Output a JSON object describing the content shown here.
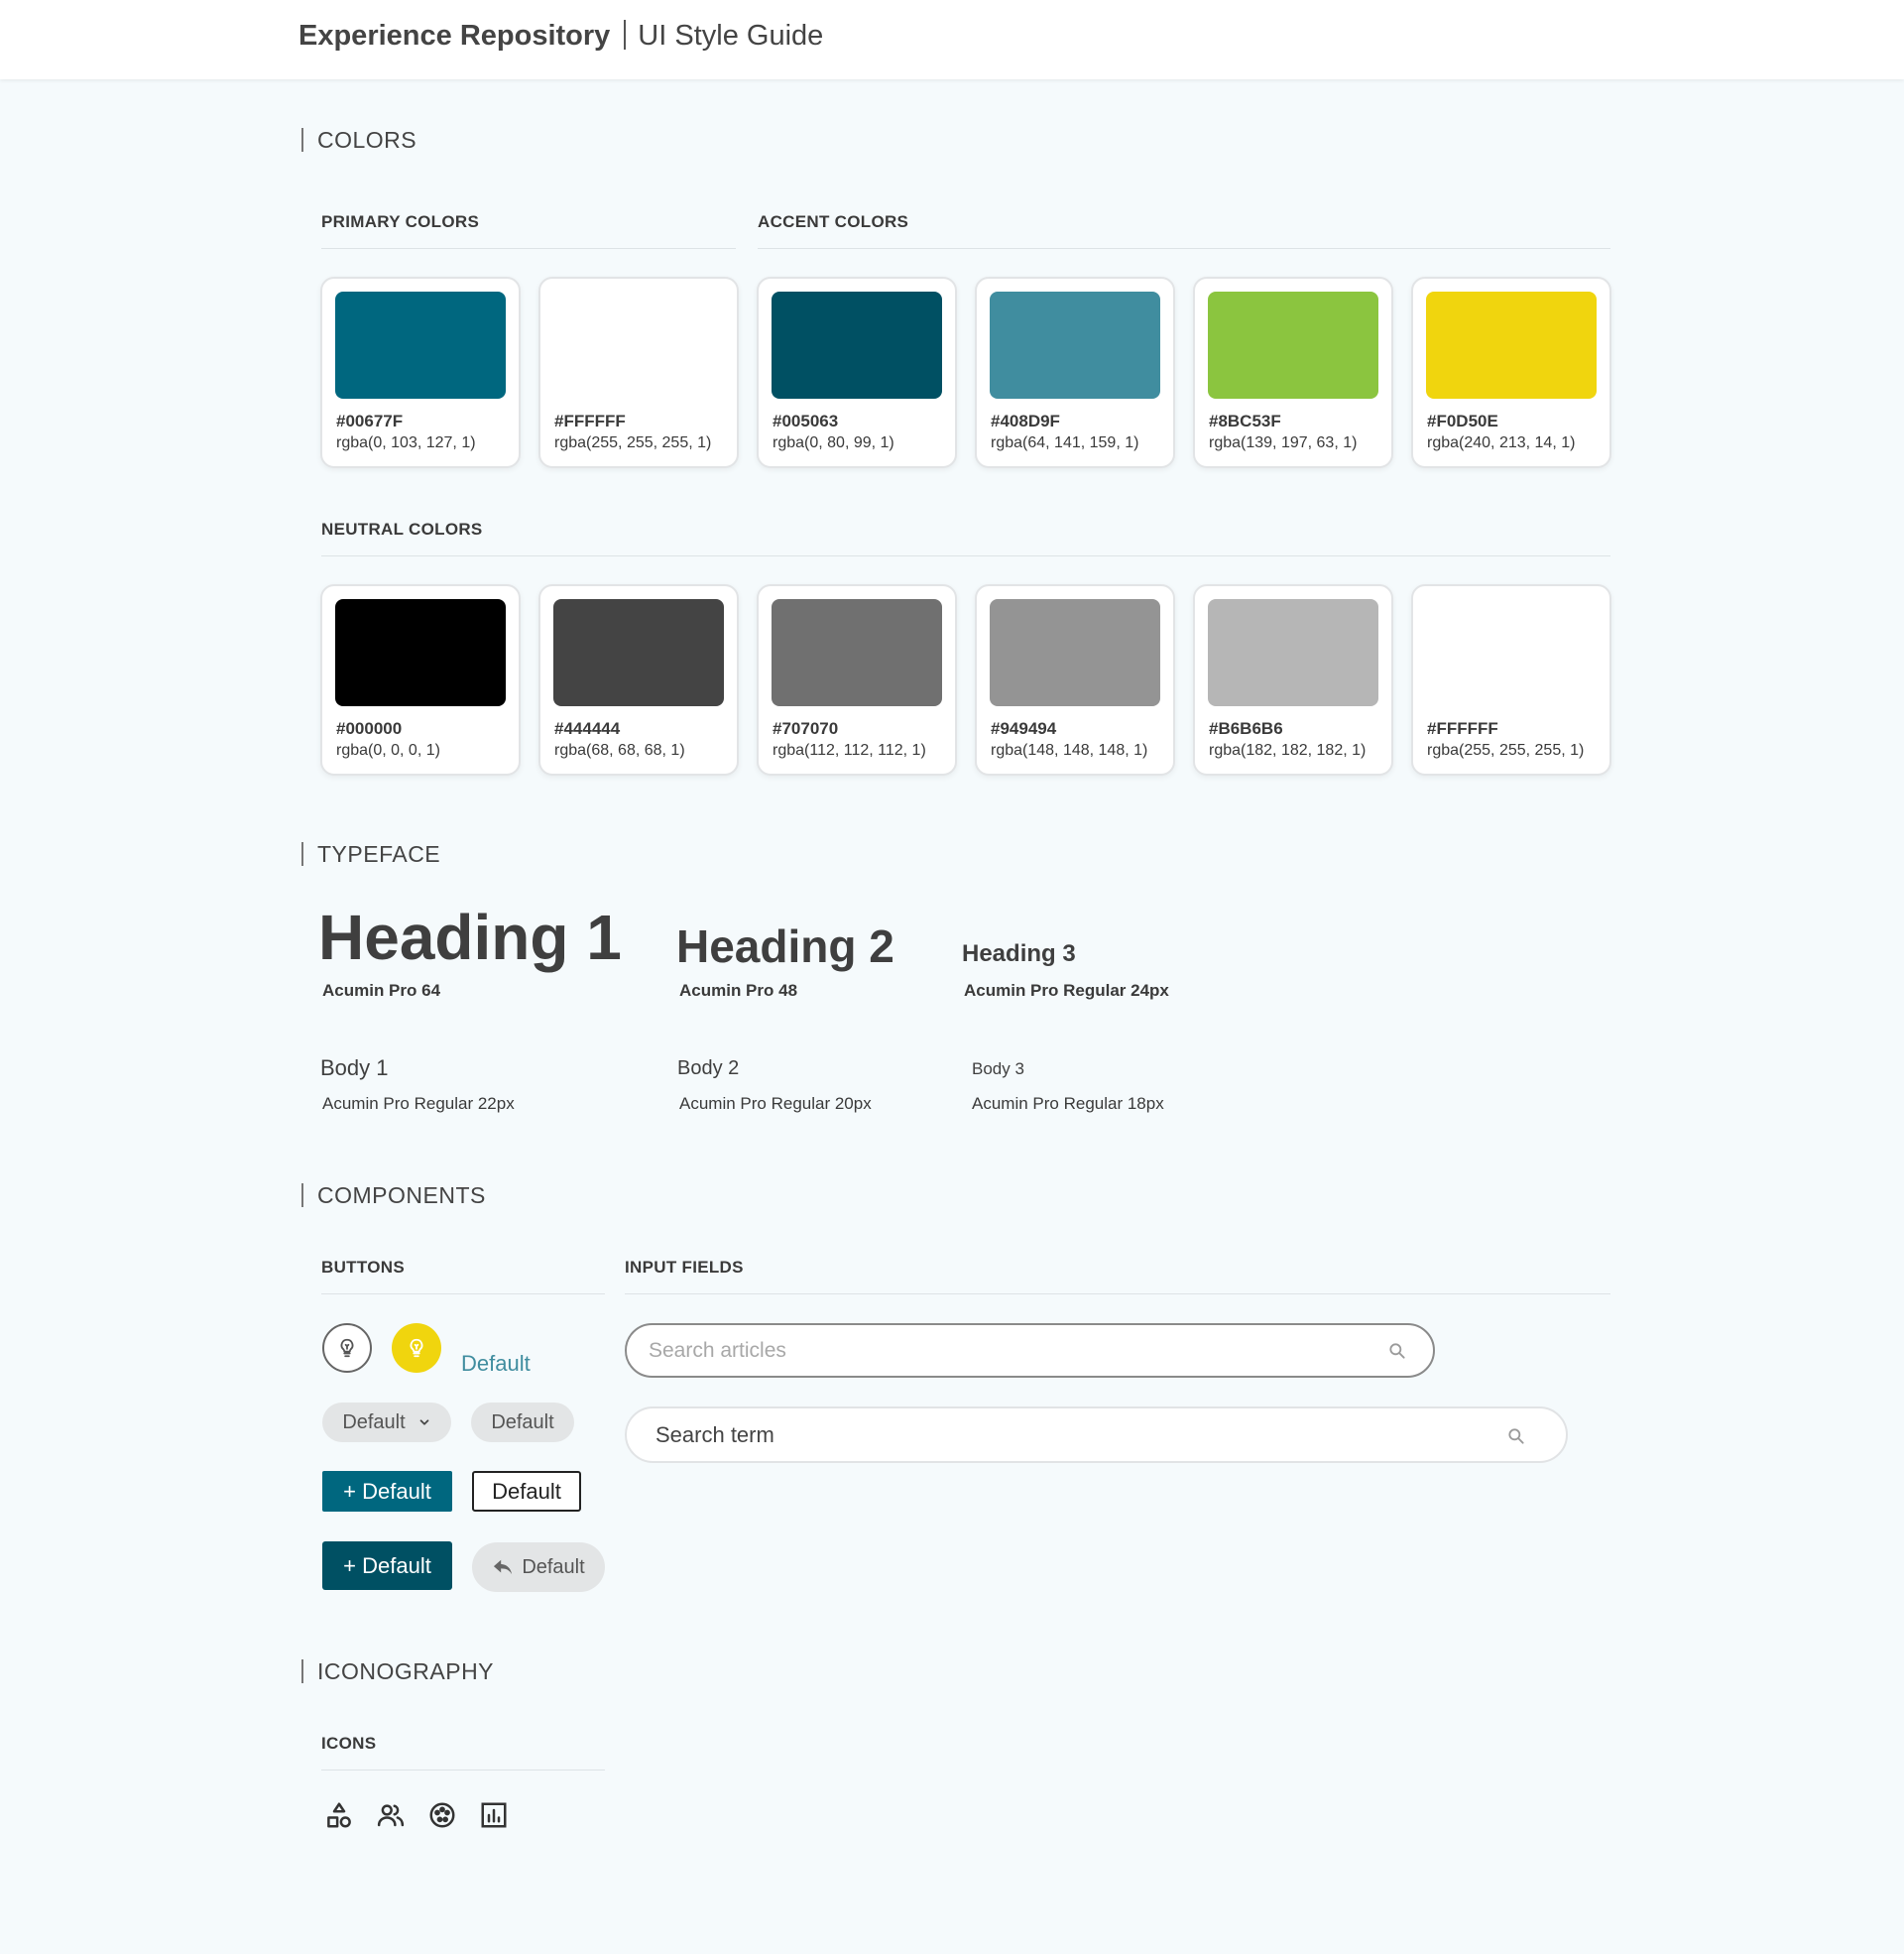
{
  "header": {
    "brand": "Experience Repository",
    "subtitle": "UI Style Guide"
  },
  "sections": {
    "colors": "COLORS",
    "typeface": "TYPEFACE",
    "components": "COMPONENTS",
    "iconography": "ICONOGRAPHY"
  },
  "colors": {
    "primary_title": "PRIMARY COLORS",
    "accent_title": "ACCENT COLORS",
    "neutral_title": "NEUTRAL COLORS",
    "primary": [
      {
        "hex": "#00677F",
        "rgba": "rgba(0, 103, 127, 1)",
        "color": "#00677F"
      },
      {
        "hex": "#FFFFFF",
        "rgba": "rgba(255, 255, 255, 1)",
        "color": "#FFFFFF"
      }
    ],
    "accent": [
      {
        "hex": "#005063",
        "rgba": "rgba(0, 80, 99, 1)",
        "color": "#005063"
      },
      {
        "hex": "#408D9F",
        "rgba": "rgba(64, 141, 159, 1)",
        "color": "#408D9F"
      },
      {
        "hex": "#8BC53F",
        "rgba": "rgba(139, 197, 63, 1)",
        "color": "#8BC53F"
      },
      {
        "hex": "#F0D50E",
        "rgba": "rgba(240, 213, 14, 1)",
        "color": "#F0D50E"
      }
    ],
    "neutral": [
      {
        "hex": "#000000",
        "rgba": "rgba(0, 0, 0, 1)",
        "color": "#000000"
      },
      {
        "hex": "#444444",
        "rgba": "rgba(68, 68, 68, 1)",
        "color": "#444444"
      },
      {
        "hex": "#707070",
        "rgba": "rgba(112, 112, 112, 1)",
        "color": "#707070"
      },
      {
        "hex": "#949494",
        "rgba": "rgba(148, 148, 148, 1)",
        "color": "#949494"
      },
      {
        "hex": "#B6B6B6",
        "rgba": "rgba(182, 182, 182, 1)",
        "color": "#B6B6B6"
      },
      {
        "hex": "#FFFFFF",
        "rgba": "rgba(255, 255, 255, 1)",
        "color": "#FFFFFF"
      }
    ]
  },
  "typeface": {
    "h1": {
      "sample": "Heading 1",
      "caption": "Acumin Pro 64"
    },
    "h2": {
      "sample": "Heading 2",
      "caption": "Acumin Pro 48"
    },
    "h3": {
      "sample": "Heading 3",
      "caption": "Acumin Pro Regular 24px"
    },
    "body1": {
      "sample": "Body 1",
      "caption": "Acumin Pro Regular 22px"
    },
    "body2": {
      "sample": "Body 2",
      "caption": "Acumin Pro Regular 20px"
    },
    "body3": {
      "sample": "Body 3",
      "caption": "Acumin Pro Regular 18px"
    }
  },
  "components": {
    "buttons_title": "BUTTONS",
    "inputs_title": "INPUT FIELDS",
    "link_button": "Default",
    "dropdown_button": "Default",
    "grey_button": "Default",
    "primary_add_button": "+ Default",
    "outline_button": "Default",
    "dark_add_button": "+ Default",
    "back_button": "Default",
    "search1_placeholder": "Search articles",
    "search2_value": "Search term"
  },
  "iconography": {
    "icons_title": "ICONS",
    "icons": [
      "shapes-icon",
      "users-icon",
      "palette-icon",
      "bar-chart-icon"
    ]
  },
  "accents": {
    "brand": "#00677F",
    "brand_dark": "#005063",
    "link": "#408D9F",
    "highlight": "#F0D50E"
  }
}
